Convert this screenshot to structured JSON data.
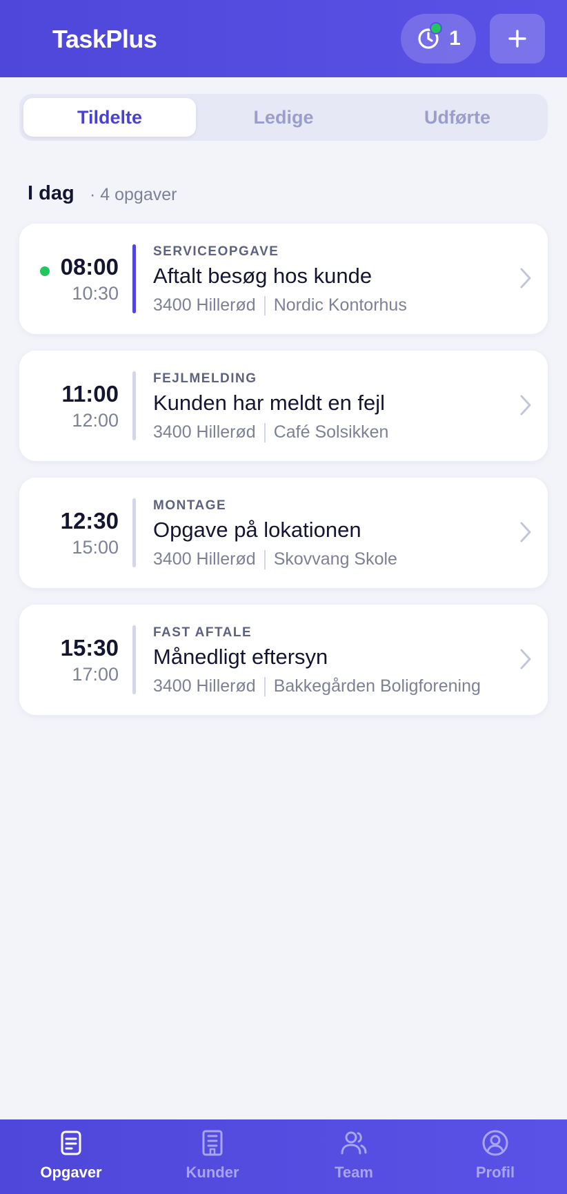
{
  "header": {
    "title": "TaskPlus",
    "timer_count": "1",
    "accent": "#4f47d9"
  },
  "tabs": [
    {
      "label": "Tildelte",
      "active": true
    },
    {
      "label": "Ledige",
      "active": false
    },
    {
      "label": "Udførte",
      "active": false
    }
  ],
  "section": {
    "title": "I dag",
    "count": "· 4 opgaver"
  },
  "tasks": [
    {
      "start": "08:00",
      "end": "10:30",
      "category": "SERVICEOPGAVE",
      "title": "Aftalt besøg hos kunde",
      "location": "3400 Hillerød",
      "customer": "Nordic Kontorhus",
      "active": true
    },
    {
      "start": "11:00",
      "end": "12:00",
      "category": "FEJLMELDING",
      "title": "Kunden har meldt en fejl",
      "location": "3400 Hillerød",
      "customer": "Café Solsikken",
      "active": false
    },
    {
      "start": "12:30",
      "end": "15:00",
      "category": "MONTAGE",
      "title": "Opgave på lokationen",
      "location": "3400 Hillerød",
      "customer": "Skovvang Skole",
      "active": false
    },
    {
      "start": "15:30",
      "end": "17:00",
      "category": "FAST AFTALE",
      "title": "Månedligt eftersyn",
      "location": "3400 Hillerød",
      "customer": "Bakkegården Boligforening",
      "active": false
    }
  ],
  "nav": [
    {
      "label": "Opgaver",
      "icon": "clipboard-icon",
      "active": true
    },
    {
      "label": "Kunder",
      "icon": "building-icon",
      "active": false
    },
    {
      "label": "Team",
      "icon": "users-icon",
      "active": false
    },
    {
      "label": "Profil",
      "icon": "user-circle-icon",
      "active": false
    }
  ]
}
